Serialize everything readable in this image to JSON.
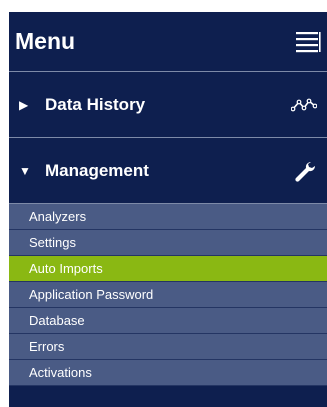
{
  "menu": {
    "title": "Menu",
    "hamburger_icon": "hamburger-menu-icon"
  },
  "sections": [
    {
      "label": "Data History",
      "arrow": "▶",
      "expanded": false,
      "icon": "trend-line-icon"
    },
    {
      "label": "Management",
      "arrow": "▼",
      "expanded": true,
      "icon": "wrench-icon"
    }
  ],
  "management_items": [
    {
      "label": "Analyzers",
      "active": false
    },
    {
      "label": "Settings",
      "active": false
    },
    {
      "label": "Auto Imports",
      "active": true
    },
    {
      "label": "Application Password",
      "active": false
    },
    {
      "label": "Database",
      "active": false
    },
    {
      "label": "Errors",
      "active": false
    },
    {
      "label": "Activations",
      "active": false
    }
  ],
  "colors": {
    "panel_background": "#0e1f4f",
    "submenu_background": "#4a5b85",
    "active_item": "#8ab813",
    "text": "#ffffff"
  }
}
